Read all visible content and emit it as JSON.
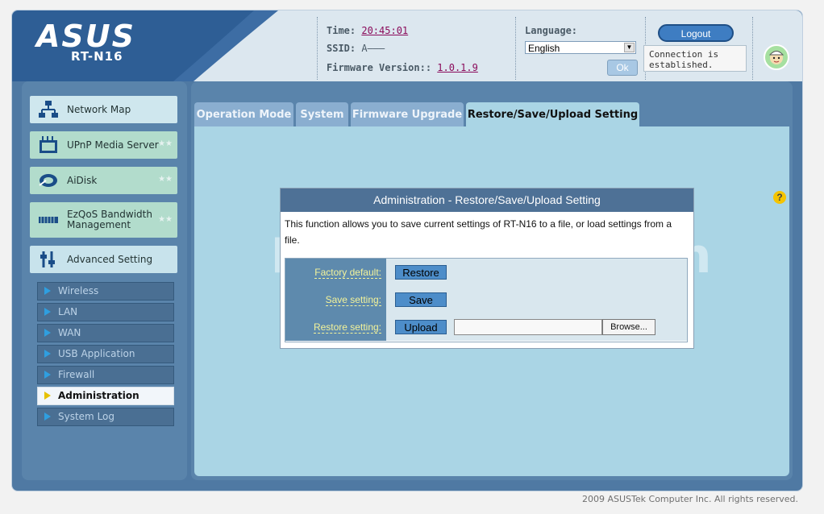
{
  "header": {
    "brand": "ASUS",
    "model": "RT-N16",
    "time_label": "Time:",
    "time_value": "20:45:01",
    "ssid_label": "SSID:",
    "ssid_value": "A———",
    "firmware_label": "Firmware Version::",
    "firmware_value": "1.0.1.9",
    "language_label": "Language:",
    "language_value": "English",
    "ok_label": "Ok",
    "logout_label": "Logout",
    "connection_status": "Connection is established."
  },
  "sidebar": {
    "main_items": [
      {
        "label": "Network Map",
        "icon": "network-map-icon"
      },
      {
        "label": "UPnP Media Server",
        "icon": "media-server-icon"
      },
      {
        "label": "AiDisk",
        "icon": "aidisk-icon"
      },
      {
        "label": "EzQoS Bandwidth Management",
        "icon": "qos-icon"
      },
      {
        "label": "Advanced Setting",
        "icon": "advanced-setting-icon"
      }
    ],
    "sub_items": [
      {
        "label": "Wireless"
      },
      {
        "label": "LAN"
      },
      {
        "label": "WAN"
      },
      {
        "label": "USB Application"
      },
      {
        "label": "Firewall"
      },
      {
        "label": "Administration"
      },
      {
        "label": "System Log"
      }
    ],
    "active_sub": "Administration"
  },
  "tabs": [
    {
      "label": "Operation Mode"
    },
    {
      "label": "System"
    },
    {
      "label": "Firmware Upgrade"
    },
    {
      "label": "Restore/Save/Upload Setting"
    }
  ],
  "panel": {
    "title": "Administration - Restore/Save/Upload Setting",
    "description": "This function allows you to save current settings of RT-N16 to a file, or load settings from a file.",
    "rows": [
      {
        "label": "Factory default:",
        "button": "Restore"
      },
      {
        "label": "Save setting:",
        "button": "Save"
      },
      {
        "label": "Restore setting:",
        "button": "Upload",
        "file_value": "",
        "browse": "Browse..."
      }
    ]
  },
  "watermark": "PcWinTech.com",
  "footer": "2009 ASUSTek Computer Inc. All rights reserved."
}
